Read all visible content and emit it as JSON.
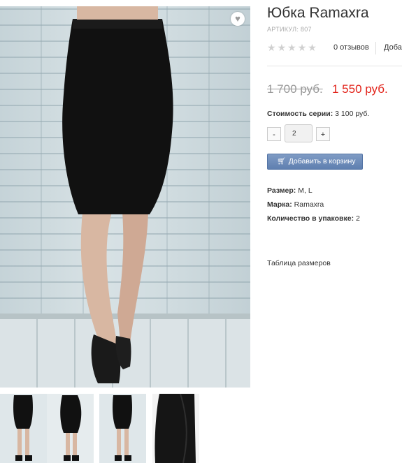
{
  "product": {
    "title": "Юбка Ramaxra",
    "sku": "АРТИКУЛ: 807",
    "reviews": "0 отзывов",
    "add_review": "Добавить отзыв",
    "old_price": "1 700 руб.",
    "new_price": "1 550 руб.",
    "series_cost_label": "Стоимость серии:",
    "series_cost_value": "3 100 руб.",
    "quantity": "2",
    "qty_minus": "-",
    "qty_plus": "+",
    "add_to_cart": "Добавить в корзину",
    "size_label": "Размер:",
    "size_value": "M, L",
    "brand_label": "Марка:",
    "brand_value": "Ramaxra",
    "pack_label": "Количество в упаковке:",
    "pack_value": "2",
    "size_table": "Таблица размеров",
    "rating": 0,
    "rating_max": 5
  },
  "icons": {
    "favorite": "heart-icon",
    "cart": "cart-icon",
    "star": "star-icon"
  },
  "colors": {
    "price_accent": "#e2231a",
    "button": "#6f8dbd",
    "skirt": "#111111"
  }
}
